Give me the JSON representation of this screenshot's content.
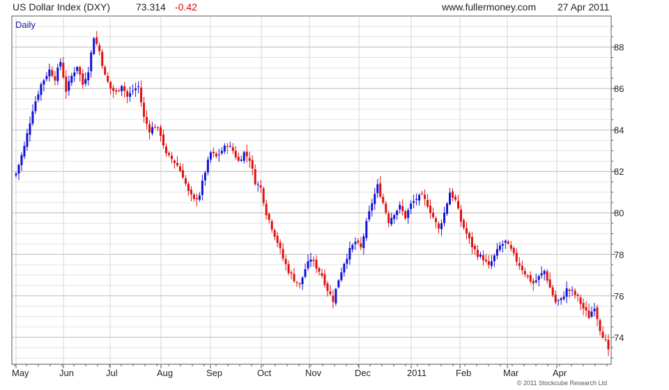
{
  "header": {
    "title": "US Dollar Index (DXY)",
    "last": "73.314",
    "change": "-0.42",
    "site": "www.fullermoney.com",
    "date": "27 Apr 2011"
  },
  "colors": {
    "up": "#1010d8",
    "down": "#e01010",
    "grid": "#d0d0d0",
    "frame": "#555555"
  },
  "chart_data": {
    "type": "candlestick",
    "period_label": "Daily",
    "copyright": "© 2011 Stockcube Research Ltd",
    "x_ticks": [
      "May",
      "Jun",
      "Jul",
      "Aug",
      "Sep",
      "Oct",
      "Nov",
      "Dec",
      "2011",
      "Feb",
      "Mar",
      "Apr"
    ],
    "y_ticks": [
      74,
      76,
      78,
      80,
      82,
      84,
      86,
      88
    ],
    "ylim": [
      72.7,
      89.5
    ],
    "grid": true,
    "series_close": [
      [
        0,
        81.9
      ],
      [
        3,
        83.2
      ],
      [
        6,
        85.0
      ],
      [
        9,
        86.2
      ],
      [
        12,
        86.9
      ],
      [
        14,
        86.5
      ],
      [
        16,
        87.3
      ],
      [
        18,
        85.9
      ],
      [
        20,
        86.6
      ],
      [
        22,
        87.1
      ],
      [
        24,
        86.2
      ],
      [
        26,
        86.9
      ],
      [
        28,
        88.5
      ],
      [
        30,
        87.8
      ],
      [
        32,
        86.6
      ],
      [
        34,
        86.0
      ],
      [
        36,
        85.8
      ],
      [
        38,
        86.2
      ],
      [
        40,
        85.6
      ],
      [
        42,
        85.9
      ],
      [
        44,
        86.1
      ],
      [
        46,
        84.6
      ],
      [
        48,
        84.0
      ],
      [
        50,
        84.2
      ],
      [
        52,
        83.8
      ],
      [
        54,
        82.8
      ],
      [
        56,
        82.6
      ],
      [
        58,
        82.3
      ],
      [
        60,
        81.8
      ],
      [
        62,
        81.0
      ],
      [
        64,
        80.6
      ],
      [
        66,
        80.9
      ],
      [
        68,
        82.0
      ],
      [
        70,
        82.9
      ],
      [
        72,
        82.7
      ],
      [
        74,
        83.0
      ],
      [
        76,
        83.3
      ],
      [
        78,
        83.0
      ],
      [
        80,
        82.5
      ],
      [
        82,
        82.9
      ],
      [
        84,
        82.6
      ],
      [
        86,
        81.5
      ],
      [
        88,
        81.2
      ],
      [
        90,
        80.0
      ],
      [
        92,
        79.3
      ],
      [
        94,
        78.6
      ],
      [
        96,
        77.8
      ],
      [
        98,
        77.2
      ],
      [
        100,
        76.8
      ],
      [
        102,
        76.5
      ],
      [
        104,
        77.3
      ],
      [
        106,
        77.8
      ],
      [
        108,
        77.4
      ],
      [
        110,
        77.0
      ],
      [
        112,
        76.3
      ],
      [
        114,
        75.8
      ],
      [
        116,
        76.8
      ],
      [
        118,
        77.6
      ],
      [
        120,
        78.2
      ],
      [
        122,
        78.6
      ],
      [
        124,
        78.3
      ],
      [
        126,
        79.5
      ],
      [
        128,
        80.5
      ],
      [
        130,
        81.3
      ],
      [
        132,
        80.5
      ],
      [
        134,
        79.6
      ],
      [
        136,
        80.0
      ],
      [
        138,
        80.3
      ],
      [
        140,
        79.8
      ],
      [
        142,
        80.4
      ],
      [
        144,
        80.7
      ],
      [
        146,
        80.8
      ],
      [
        148,
        80.4
      ],
      [
        150,
        79.8
      ],
      [
        152,
        79.2
      ],
      [
        154,
        80.0
      ],
      [
        156,
        81.0
      ],
      [
        158,
        80.6
      ],
      [
        160,
        79.6
      ],
      [
        162,
        79.0
      ],
      [
        164,
        78.4
      ],
      [
        166,
        78.0
      ],
      [
        168,
        77.8
      ],
      [
        170,
        77.4
      ],
      [
        172,
        77.9
      ],
      [
        174,
        78.4
      ],
      [
        176,
        78.6
      ],
      [
        178,
        78.2
      ],
      [
        180,
        77.7
      ],
      [
        182,
        77.3
      ],
      [
        184,
        76.9
      ],
      [
        186,
        76.6
      ],
      [
        188,
        76.9
      ],
      [
        190,
        77.2
      ],
      [
        192,
        76.4
      ],
      [
        194,
        75.7
      ],
      [
        196,
        75.8
      ],
      [
        198,
        76.3
      ],
      [
        200,
        76.2
      ],
      [
        202,
        75.9
      ],
      [
        204,
        75.4
      ],
      [
        206,
        75.0
      ],
      [
        208,
        75.5
      ],
      [
        210,
        74.4
      ],
      [
        212,
        73.8
      ],
      [
        213,
        73.3
      ]
    ]
  }
}
